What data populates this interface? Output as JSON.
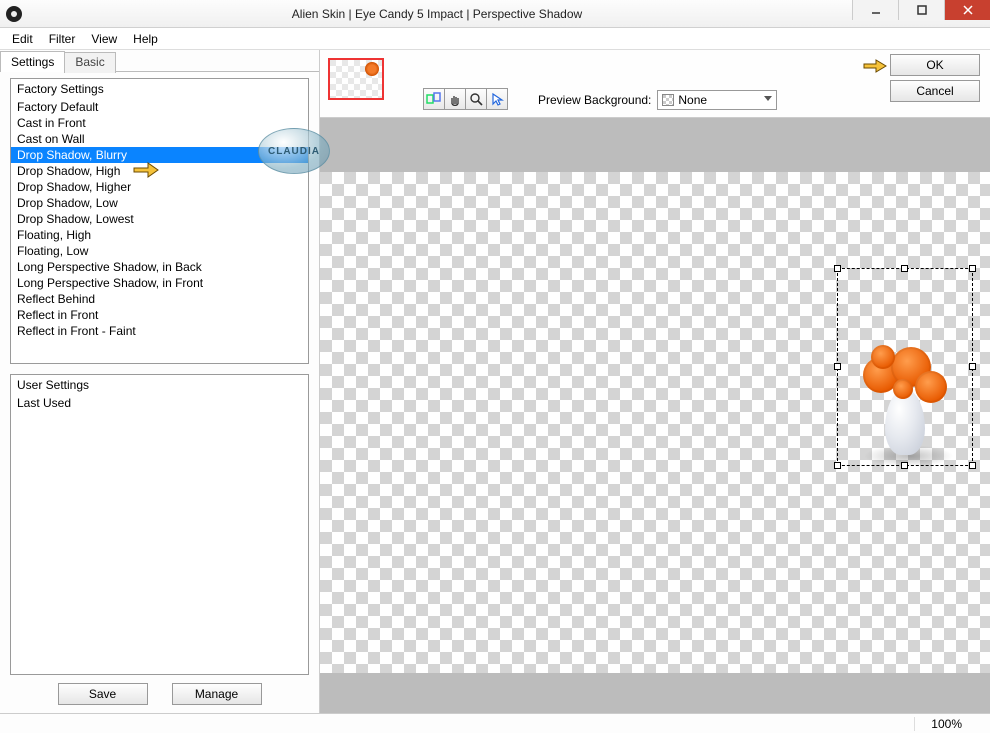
{
  "window": {
    "title": "Alien Skin | Eye Candy 5 Impact | Perspective Shadow"
  },
  "menu": {
    "items": [
      "Edit",
      "Filter",
      "View",
      "Help"
    ]
  },
  "tabs": {
    "active": "Settings",
    "inactive": "Basic"
  },
  "factory": {
    "header": "Factory Settings",
    "items": [
      "Factory Default",
      "Cast in Front",
      "Cast on Wall",
      "Drop Shadow, Blurry",
      "Drop Shadow, High",
      "Drop Shadow, Higher",
      "Drop Shadow, Low",
      "Drop Shadow, Lowest",
      "Floating, High",
      "Floating, Low",
      "Long Perspective Shadow, in Back",
      "Long Perspective Shadow, in Front",
      "Reflect Behind",
      "Reflect in Front",
      "Reflect in Front - Faint"
    ],
    "selected_index": 3
  },
  "user": {
    "header": "User Settings",
    "items": [
      "Last Used"
    ]
  },
  "buttons": {
    "save": "Save",
    "manage": "Manage",
    "ok": "OK",
    "cancel": "Cancel"
  },
  "preview": {
    "label": "Preview Background:",
    "value": "None"
  },
  "status": {
    "zoom": "100%"
  },
  "stamp": "CLAUDIA"
}
